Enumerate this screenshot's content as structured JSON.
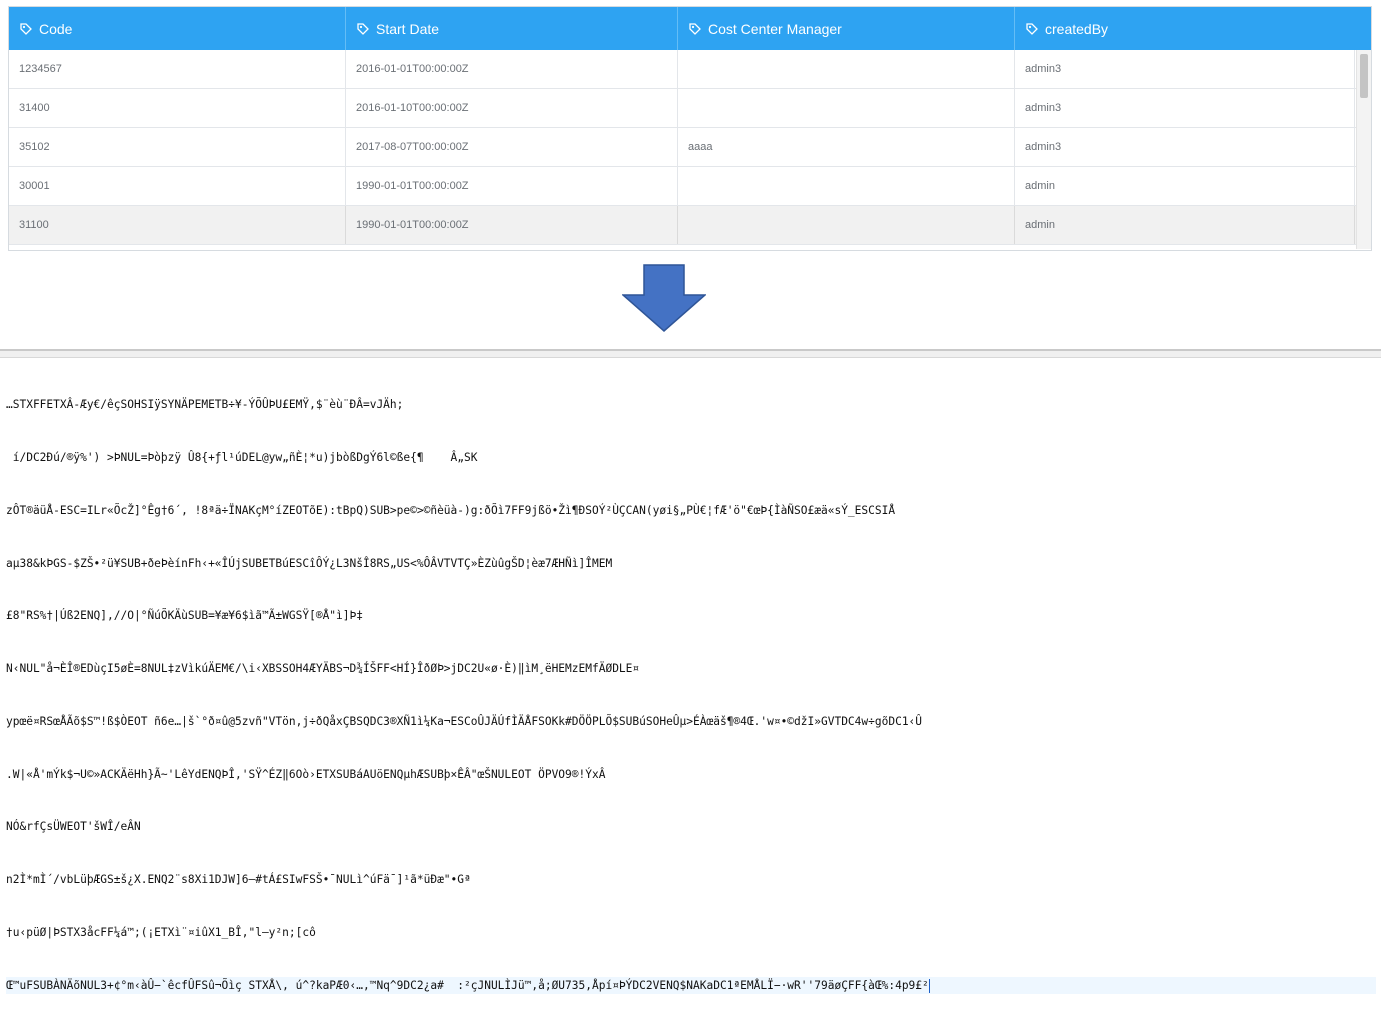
{
  "table": {
    "columns": [
      {
        "label": "Code"
      },
      {
        "label": "Start Date"
      },
      {
        "label": "Cost Center Manager"
      },
      {
        "label": "createdBy"
      }
    ],
    "rows": [
      {
        "code": "1234567",
        "start_date": "2016-01-01T00:00:00Z",
        "manager": "",
        "created_by": "admin3"
      },
      {
        "code": "31400",
        "start_date": "2016-01-10T00:00:00Z",
        "manager": "",
        "created_by": "admin3"
      },
      {
        "code": "35102",
        "start_date": "2017-08-07T00:00:00Z",
        "manager": "aaaa",
        "created_by": "admin3"
      },
      {
        "code": "30001",
        "start_date": "1990-01-01T00:00:00Z",
        "manager": "",
        "created_by": "admin"
      },
      {
        "code": "31100",
        "start_date": "1990-01-01T00:00:00Z",
        "manager": "",
        "created_by": "admin"
      }
    ],
    "header_color": "#2ea3f2",
    "selected_row_index": 4
  },
  "arrow": {
    "color": "#4472c4",
    "direction": "down"
  },
  "binary_view": {
    "lines": [
      "…STXFFETXÂ-Æy€/êçSOHSIÿSYNÄPEMETB÷¥-ÝÕÛÞU£EMŸ,$¨èù¨ÐÂ=vJÄh;",
      " í/DC2Ðú/®ÿ%') >ÞNUL=Þòþzÿ Û8{+ƒl¹úDEL@yw„ñÈ¦*u)jbòßDgÝ6l©ße{¶    Â„SK",
      "zÔT®äüÅ-ESC=ILr«ÕcŽ]°Êg†6´, !8ªä÷ÏNAKçM°íZEOTõE):tBpQ)SUB>pe©>©ñèüà-)g:ðÕì7FF9jßö•Žì¶ÐSOÝ²ÙÇCAN(yøi§„PÙ€¦fÆ'ö\"€œÞ{ÌàÑSO£æä«sÝ_ESCSIÅ",
      "aµ38&kÞGS-$ZŠ•²ü¥SUB+ðeÞèínFh‹+«ÎÚjSUBETBúESCîÔÝ¿L3NšÎ8RS„US<%ÔÂVTVTÇ»ÈZùûgŠD¦èæ7ÆHÑì]ÎMEM",
      "£8\"RS%†|Úß2ENQ],//O|°ÑúÕKÄùSUB=¥æ¥6$ìã™Ã±WGSŸ[®Å\"ì]Þ‡",
      "N‹NUL\"å¬ÈÎ®EDùçI5øÈ=8NUL‡zVìkúÄEM€/\\i‹XBSSOH4ÆYÄBS¬D¾ÍŠFF<HÍ}ÎðØÞ>jDC2U«ø·È)‖ìM¸ëHEMzEMfÄØDLE¤",
      "ypœë¤RSœÅÃõ$S™!ß$ÒEOT ñ6e…|š`°ð¤û@5zvñ\"VTön,j÷ðQåxÇBSQDC3®XÑ1ì¼Ka¬ESCoÛJÄÚfÌÄÅFSOKk#DÖÖPLÕ$SUBúSOHeÛµ>ÉÀœäš¶®4Œ.'w¤•©džI»GVTDC4w÷gõDC1‹Û",
      ".W|«Å'mÝk$¬U©»ACKÄëHh}Ã~'LêYdENQÞÎ,'SŸ^ÉZ‖6Oò›ETXSUBáAUöENQµhÆSUBþ×ÊÂ\"œŠNULEOT ÖPVO9®!ÝxÂ",
      "NÓ&rfÇsÜWEOT'šWÎ/eÂN",
      "n2Ì*mÌ´/vbLüþÆGS±š¿X.ENQ2¨s8Xi1DJW]6—#tÁ£SIwFSŠ•¯NULì^úFä¯]¹ã*üÐæ\"•Gª",
      "†u‹püØ|ÞSTX3åcFF¼á™;(¡ETXì¨¤iûX1_BÎ,\"l—y²n;[cô",
      "Œ™uFSUBÀNÄõNUL3+¢°m‹àÛ−`êcfÛFSû¬Õìç STXÅ\\, ú^?kaPÆ0‹…,™Nq^9DC2¿a#  :²çJNULÌJü™,å;ØU735,Åpí¤ÞÝDC2VENQ$NAKaDC1ªEMÅLÏ−·wR''79äøÇFF{àŒ%:4p9£²"
    ]
  }
}
